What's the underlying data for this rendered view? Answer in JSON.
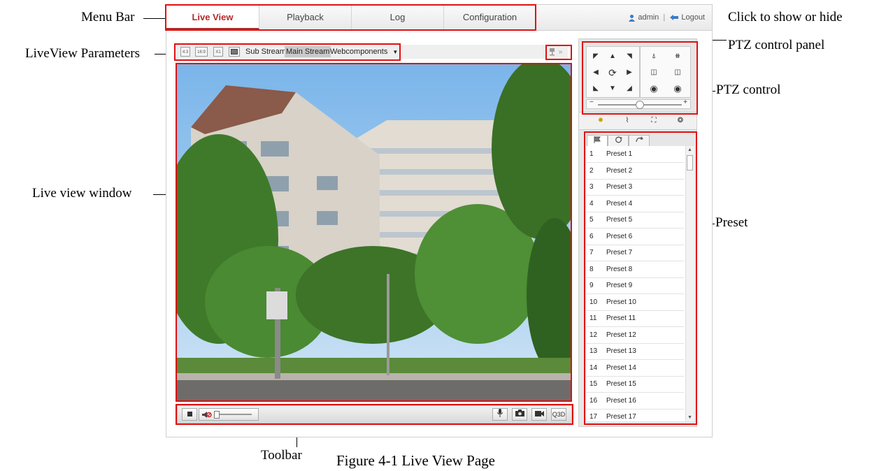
{
  "callouts": {
    "menu_bar": "Menu Bar",
    "liveview_params": "LiveView Parameters",
    "live_view_window": "Live view window",
    "toolbar": "Toolbar",
    "click_show_hide": "Click to show or hide",
    "ptz_panel": "PTZ control panel",
    "ptz_control": "PTZ control",
    "preset": "Preset"
  },
  "caption": "Figure 4-1 Live View Page",
  "menu": {
    "tabs": [
      {
        "label": "Live View",
        "active": true
      },
      {
        "label": "Playback",
        "active": false
      },
      {
        "label": "Log",
        "active": false
      },
      {
        "label": "Configuration",
        "active": false
      }
    ],
    "user": "admin",
    "separator": "|",
    "logout": "Logout"
  },
  "params": {
    "ratio_4_3": "4:3",
    "ratio_16_9": "16:9",
    "ratio_x1": "X1",
    "sub_stream": "Sub Stream",
    "main_stream": "Main Stream",
    "plugin": "Webcomponents",
    "expand": "»"
  },
  "ptz": {
    "slider_minus": "−",
    "slider_plus": "+"
  },
  "presets": [
    {
      "num": "1",
      "name": "Preset 1"
    },
    {
      "num": "2",
      "name": "Preset 2"
    },
    {
      "num": "3",
      "name": "Preset 3"
    },
    {
      "num": "4",
      "name": "Preset 4"
    },
    {
      "num": "5",
      "name": "Preset 5"
    },
    {
      "num": "6",
      "name": "Preset 6"
    },
    {
      "num": "7",
      "name": "Preset 7"
    },
    {
      "num": "8",
      "name": "Preset 8"
    },
    {
      "num": "9",
      "name": "Preset 9"
    },
    {
      "num": "10",
      "name": "Preset 10"
    },
    {
      "num": "11",
      "name": "Preset 11"
    },
    {
      "num": "12",
      "name": "Preset 12"
    },
    {
      "num": "13",
      "name": "Preset 13"
    },
    {
      "num": "14",
      "name": "Preset 14"
    },
    {
      "num": "15",
      "name": "Preset 15"
    },
    {
      "num": "16",
      "name": "Preset 16"
    },
    {
      "num": "17",
      "name": "Preset 17"
    }
  ],
  "toolbar": {
    "zoom3d_label": "Q3D"
  },
  "colors": {
    "accent": "#b52a2a",
    "annotation": "#e01010"
  }
}
